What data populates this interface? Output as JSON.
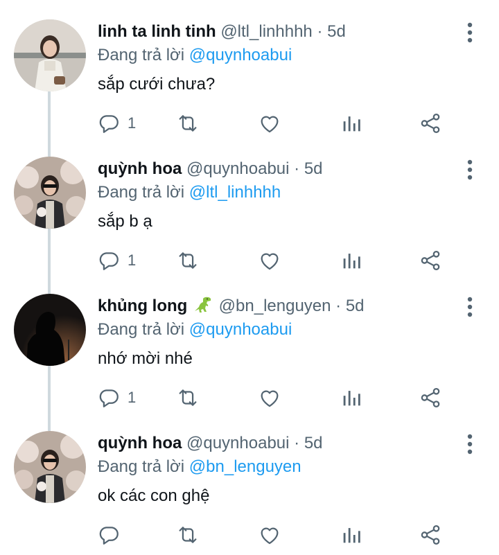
{
  "replying_prefix": "Đang trả lời",
  "tweets": [
    {
      "name": "linh ta linh tinh",
      "handle": "@ltl_linhhhh",
      "separator": "·",
      "time": "5d",
      "reply_to": "@quynhoabui",
      "text": "sắp cưới chưa?",
      "reply_count": "1",
      "avatar": "avatar-girl-white-sweater"
    },
    {
      "name": "quỳnh hoa",
      "handle": "@quynhoabui",
      "separator": "·",
      "time": "5d",
      "reply_to": "@ltl_linhhhh",
      "text": "sắp b ạ",
      "reply_count": "1",
      "avatar": "avatar-girl-sunglasses-blossoms"
    },
    {
      "name": "khủng long",
      "handle": "@bn_lenguyen",
      "separator": "·",
      "time": "5d",
      "reply_to": "@quynhoabui",
      "text": "nhớ mời nhé",
      "reply_count": "1",
      "name_emoji": "t-rex-emoji",
      "avatar": "avatar-silhouette-sunset"
    },
    {
      "name": "quỳnh hoa",
      "handle": "@quynhoabui",
      "separator": "·",
      "time": "5d",
      "reply_to": "@bn_lenguyen",
      "text": "ok các con ghệ",
      "reply_count": "",
      "avatar": "avatar-girl-sunglasses-blossoms"
    }
  ],
  "colors": {
    "link": "#1d9bf0",
    "muted": "#536471",
    "text": "#0f1419",
    "thread_line": "#cfd9de"
  },
  "icons": [
    "reply-icon",
    "retweet-icon",
    "like-icon",
    "analytics-icon",
    "share-icon",
    "more-icon"
  ]
}
